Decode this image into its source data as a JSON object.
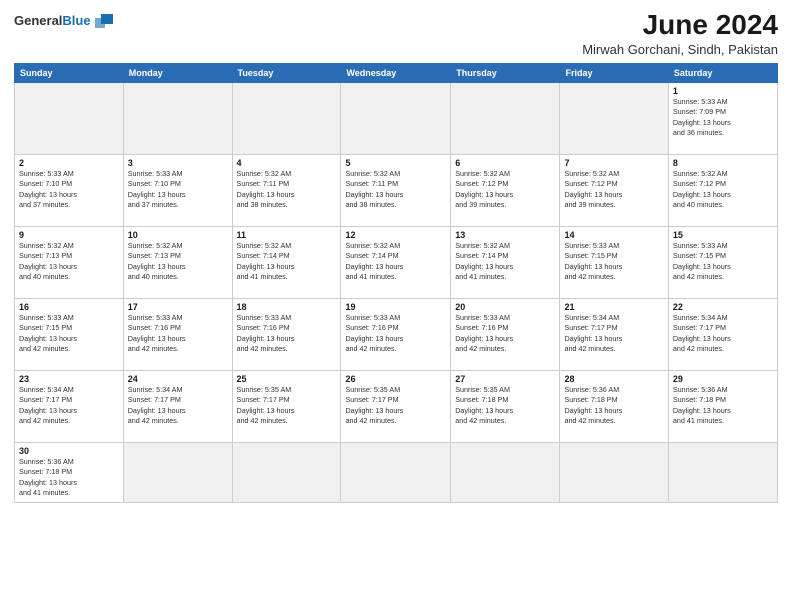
{
  "header": {
    "logo_line1": "General",
    "logo_line2": "Blue",
    "title": "June 2024",
    "subtitle": "Mirwah Gorchani, Sindh, Pakistan"
  },
  "weekdays": [
    "Sunday",
    "Monday",
    "Tuesday",
    "Wednesday",
    "Thursday",
    "Friday",
    "Saturday"
  ],
  "weeks": [
    [
      {
        "day": "",
        "info": ""
      },
      {
        "day": "",
        "info": ""
      },
      {
        "day": "",
        "info": ""
      },
      {
        "day": "",
        "info": ""
      },
      {
        "day": "",
        "info": ""
      },
      {
        "day": "",
        "info": ""
      },
      {
        "day": "1",
        "info": "Sunrise: 5:33 AM\nSunset: 7:09 PM\nDaylight: 13 hours\nand 36 minutes."
      }
    ],
    [
      {
        "day": "2",
        "info": "Sunrise: 5:33 AM\nSunset: 7:10 PM\nDaylight: 13 hours\nand 37 minutes."
      },
      {
        "day": "3",
        "info": "Sunrise: 5:33 AM\nSunset: 7:10 PM\nDaylight: 13 hours\nand 37 minutes."
      },
      {
        "day": "4",
        "info": "Sunrise: 5:32 AM\nSunset: 7:11 PM\nDaylight: 13 hours\nand 38 minutes."
      },
      {
        "day": "5",
        "info": "Sunrise: 5:32 AM\nSunset: 7:11 PM\nDaylight: 13 hours\nand 38 minutes."
      },
      {
        "day": "6",
        "info": "Sunrise: 5:32 AM\nSunset: 7:12 PM\nDaylight: 13 hours\nand 39 minutes."
      },
      {
        "day": "7",
        "info": "Sunrise: 5:32 AM\nSunset: 7:12 PM\nDaylight: 13 hours\nand 39 minutes."
      },
      {
        "day": "8",
        "info": "Sunrise: 5:32 AM\nSunset: 7:12 PM\nDaylight: 13 hours\nand 40 minutes."
      }
    ],
    [
      {
        "day": "9",
        "info": "Sunrise: 5:32 AM\nSunset: 7:13 PM\nDaylight: 13 hours\nand 40 minutes."
      },
      {
        "day": "10",
        "info": "Sunrise: 5:32 AM\nSunset: 7:13 PM\nDaylight: 13 hours\nand 40 minutes."
      },
      {
        "day": "11",
        "info": "Sunrise: 5:32 AM\nSunset: 7:14 PM\nDaylight: 13 hours\nand 41 minutes."
      },
      {
        "day": "12",
        "info": "Sunrise: 5:32 AM\nSunset: 7:14 PM\nDaylight: 13 hours\nand 41 minutes."
      },
      {
        "day": "13",
        "info": "Sunrise: 5:32 AM\nSunset: 7:14 PM\nDaylight: 13 hours\nand 41 minutes."
      },
      {
        "day": "14",
        "info": "Sunrise: 5:33 AM\nSunset: 7:15 PM\nDaylight: 13 hours\nand 42 minutes."
      },
      {
        "day": "15",
        "info": "Sunrise: 5:33 AM\nSunset: 7:15 PM\nDaylight: 13 hours\nand 42 minutes."
      }
    ],
    [
      {
        "day": "16",
        "info": "Sunrise: 5:33 AM\nSunset: 7:15 PM\nDaylight: 13 hours\nand 42 minutes."
      },
      {
        "day": "17",
        "info": "Sunrise: 5:33 AM\nSunset: 7:16 PM\nDaylight: 13 hours\nand 42 minutes."
      },
      {
        "day": "18",
        "info": "Sunrise: 5:33 AM\nSunset: 7:16 PM\nDaylight: 13 hours\nand 42 minutes."
      },
      {
        "day": "19",
        "info": "Sunrise: 5:33 AM\nSunset: 7:16 PM\nDaylight: 13 hours\nand 42 minutes."
      },
      {
        "day": "20",
        "info": "Sunrise: 5:33 AM\nSunset: 7:16 PM\nDaylight: 13 hours\nand 42 minutes."
      },
      {
        "day": "21",
        "info": "Sunrise: 5:34 AM\nSunset: 7:17 PM\nDaylight: 13 hours\nand 42 minutes."
      },
      {
        "day": "22",
        "info": "Sunrise: 5:34 AM\nSunset: 7:17 PM\nDaylight: 13 hours\nand 42 minutes."
      }
    ],
    [
      {
        "day": "23",
        "info": "Sunrise: 5:34 AM\nSunset: 7:17 PM\nDaylight: 13 hours\nand 42 minutes."
      },
      {
        "day": "24",
        "info": "Sunrise: 5:34 AM\nSunset: 7:17 PM\nDaylight: 13 hours\nand 42 minutes."
      },
      {
        "day": "25",
        "info": "Sunrise: 5:35 AM\nSunset: 7:17 PM\nDaylight: 13 hours\nand 42 minutes."
      },
      {
        "day": "26",
        "info": "Sunrise: 5:35 AM\nSunset: 7:17 PM\nDaylight: 13 hours\nand 42 minutes."
      },
      {
        "day": "27",
        "info": "Sunrise: 5:35 AM\nSunset: 7:18 PM\nDaylight: 13 hours\nand 42 minutes."
      },
      {
        "day": "28",
        "info": "Sunrise: 5:36 AM\nSunset: 7:18 PM\nDaylight: 13 hours\nand 42 minutes."
      },
      {
        "day": "29",
        "info": "Sunrise: 5:36 AM\nSunset: 7:18 PM\nDaylight: 13 hours\nand 41 minutes."
      }
    ],
    [
      {
        "day": "30",
        "info": "Sunrise: 5:36 AM\nSunset: 7:18 PM\nDaylight: 13 hours\nand 41 minutes."
      },
      {
        "day": "",
        "info": ""
      },
      {
        "day": "",
        "info": ""
      },
      {
        "day": "",
        "info": ""
      },
      {
        "day": "",
        "info": ""
      },
      {
        "day": "",
        "info": ""
      },
      {
        "day": "",
        "info": ""
      }
    ]
  ]
}
